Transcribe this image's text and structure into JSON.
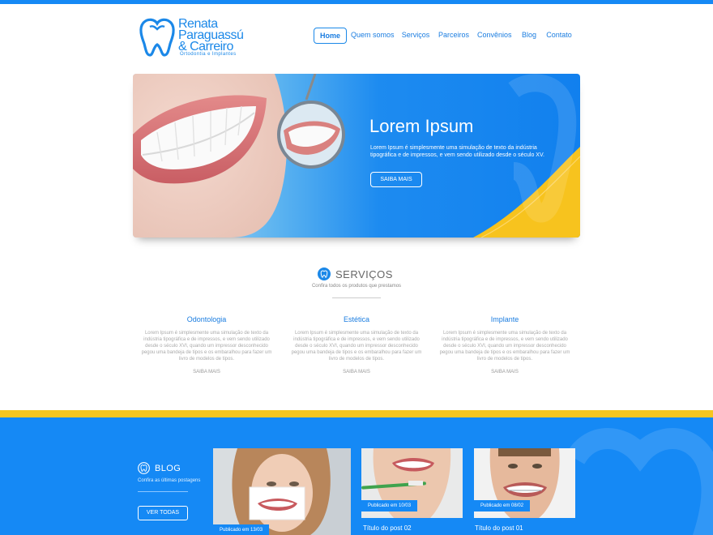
{
  "brand": {
    "name_line1": "Renata",
    "name_line2": "Paraguassú",
    "name_line3": "& Carreiro",
    "tagline": "Ortodontia e Implantes",
    "color": "#1b88e8"
  },
  "nav": {
    "items": [
      {
        "label": "Home",
        "active": true
      },
      {
        "label": "Quem somos"
      },
      {
        "label": "Serviços"
      },
      {
        "label": "Parceiros"
      },
      {
        "label": "Convênios"
      },
      {
        "label": "Blog"
      },
      {
        "label": "Contato"
      }
    ]
  },
  "hero": {
    "title": "Lorem Ipsum",
    "text": "Lorem Ipsum é simplesmente uma simulação de texto da indústria tipográfica e de impressos, e vem sendo utilizado desde o século XV.",
    "button": "SAIBA MAIS"
  },
  "services": {
    "title": "SERVIÇOS",
    "subtitle": "Confira todos os produtos que prestamos",
    "items": [
      {
        "title": "Odontologia",
        "text": "Lorem Ipsum é simplesmente uma simulação de texto da indústria tipográfica e de impressos, e vem sendo utilizado desde o século XVI, quando um impressor desconhecido pegou uma bandeja de tipos e os embaralhou para fazer um livro de modelos de tipos.",
        "more": "SAIBA MAIS"
      },
      {
        "title": "Estética",
        "text": "Lorem Ipsum é simplesmente uma simulação de texto da indústria tipográfica e de impressos, e vem sendo utilizado desde o século XVI, quando um impressor desconhecido pegou uma bandeja de tipos e os embaralhou para fazer um livro de modelos de tipos.",
        "more": "SAIBA MAIS"
      },
      {
        "title": "Implante",
        "text": "Lorem Ipsum é simplesmente uma simulação de texto da indústria tipográfica e de impressos, e vem sendo utilizado desde o século XVI, quando um impressor desconhecido pegou uma bandeja de tipos e os embaralhou para fazer um livro de modelos de tipos.",
        "more": "SAIBA MAIS"
      }
    ]
  },
  "blog": {
    "title": "BLOG",
    "subtitle": "Confira as últimas postagens",
    "button": "VER TODAS",
    "posts": [
      {
        "badge": "Publicado em  13/03",
        "title": ""
      },
      {
        "badge": "Publicado em  10/03",
        "title": "Título do post 02"
      },
      {
        "badge": "Publicado em  08/02",
        "title": "Título do post 01"
      }
    ]
  },
  "colors": {
    "primary": "#1589f5",
    "accent": "#f6c61f"
  }
}
